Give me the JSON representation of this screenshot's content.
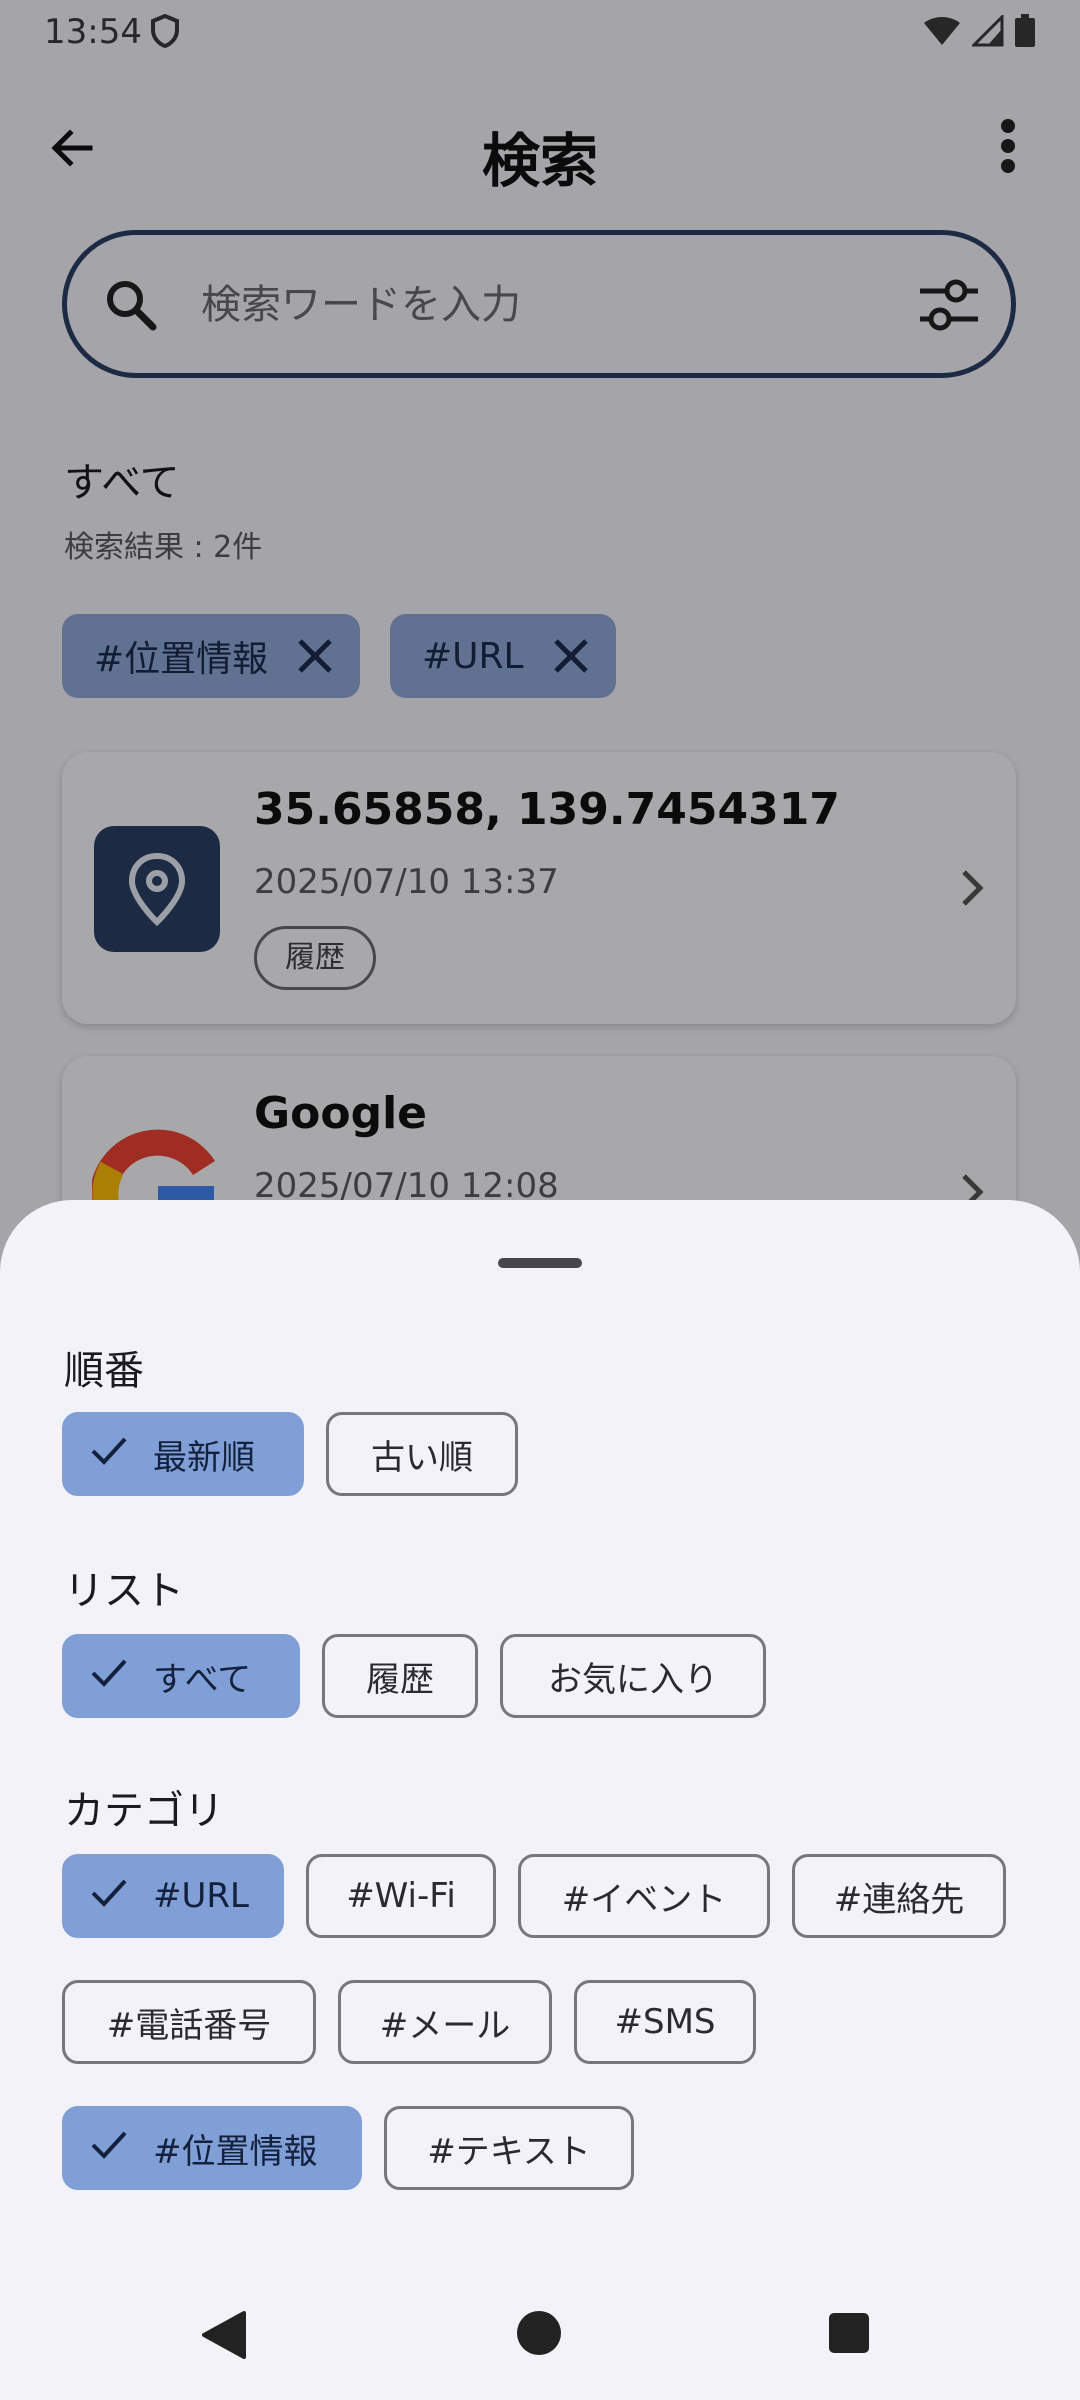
{
  "status_bar": {
    "time": "13:54",
    "icons": [
      "shield-icon",
      "wifi-icon",
      "signal-icon",
      "battery-icon"
    ]
  },
  "app_bar": {
    "title": "検索",
    "back_icon": "arrow-back-icon",
    "more_icon": "more-vert-icon"
  },
  "search": {
    "placeholder": "検索ワードを入力",
    "value": ""
  },
  "results": {
    "section_title": "すべて",
    "count_text": "検索結果 : 2件",
    "active_tags": [
      {
        "label": "#位置情報"
      },
      {
        "label": "#URL"
      }
    ],
    "items": [
      {
        "title": "35.65858, 139.7454317",
        "date": "2025/07/10 13:37",
        "badge": "履歴",
        "icon": "location-pin-icon"
      },
      {
        "title": "Google",
        "date": "2025/07/10 12:08",
        "icon": "google-logo"
      }
    ]
  },
  "sheet": {
    "order": {
      "label": "順番",
      "options": [
        {
          "label": "最新順",
          "selected": true
        },
        {
          "label": "古い順",
          "selected": false
        }
      ]
    },
    "list": {
      "label": "リスト",
      "options": [
        {
          "label": "すべて",
          "selected": true
        },
        {
          "label": "履歴",
          "selected": false
        },
        {
          "label": "お気に入り",
          "selected": false
        }
      ]
    },
    "category": {
      "label": "カテゴリ",
      "options": [
        {
          "label": "#URL",
          "selected": true
        },
        {
          "label": "#Wi-Fi",
          "selected": false
        },
        {
          "label": "#イベント",
          "selected": false
        },
        {
          "label": "#連絡先",
          "selected": false
        },
        {
          "label": "#電話番号",
          "selected": false
        },
        {
          "label": "#メール",
          "selected": false
        },
        {
          "label": "#SMS",
          "selected": false
        },
        {
          "label": "#位置情報",
          "selected": true
        },
        {
          "label": "#テキスト",
          "selected": false
        }
      ]
    }
  },
  "colors": {
    "accent": "#2c3e64",
    "selected_chip": "#7f9fd6",
    "tag_chip": "#8fa7d6",
    "background": "#f3f2f8"
  }
}
